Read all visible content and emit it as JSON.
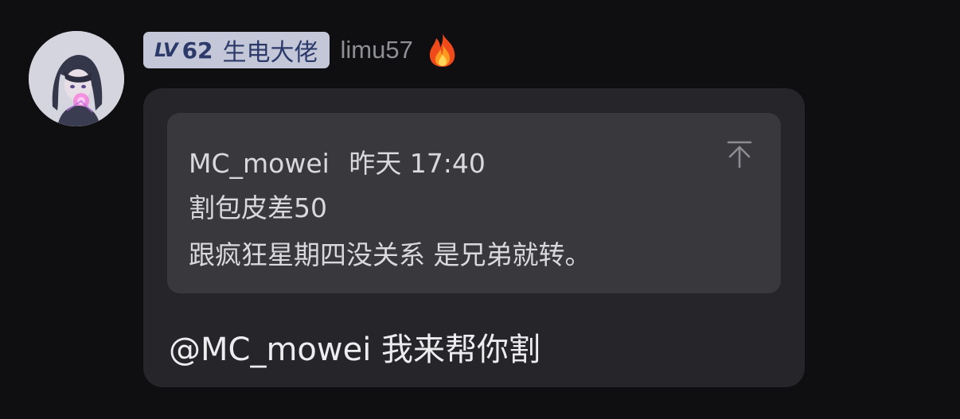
{
  "user": {
    "avatar_icon": "anime-avatar",
    "level_prefix": "LV",
    "level_number": "62",
    "level_title": "生电大佬",
    "username": "limu57",
    "badge_icon": "fire-icon",
    "badge_color": "#c3c7d8",
    "badge_text_color": "#2c3a6a"
  },
  "message": {
    "quote": {
      "author": "MC_mowei",
      "time": "昨天 17:40",
      "lines": [
        "割包皮差50",
        "跟疯狂星期四没关系 是兄弟就转。"
      ],
      "jump_icon": "arrow-up-to-top-icon"
    },
    "reply_text": "@MC_mowei 我来帮你割"
  },
  "colors": {
    "background": "#0f0f11",
    "bubble": "#26262a",
    "quote_card": "#38383d"
  }
}
